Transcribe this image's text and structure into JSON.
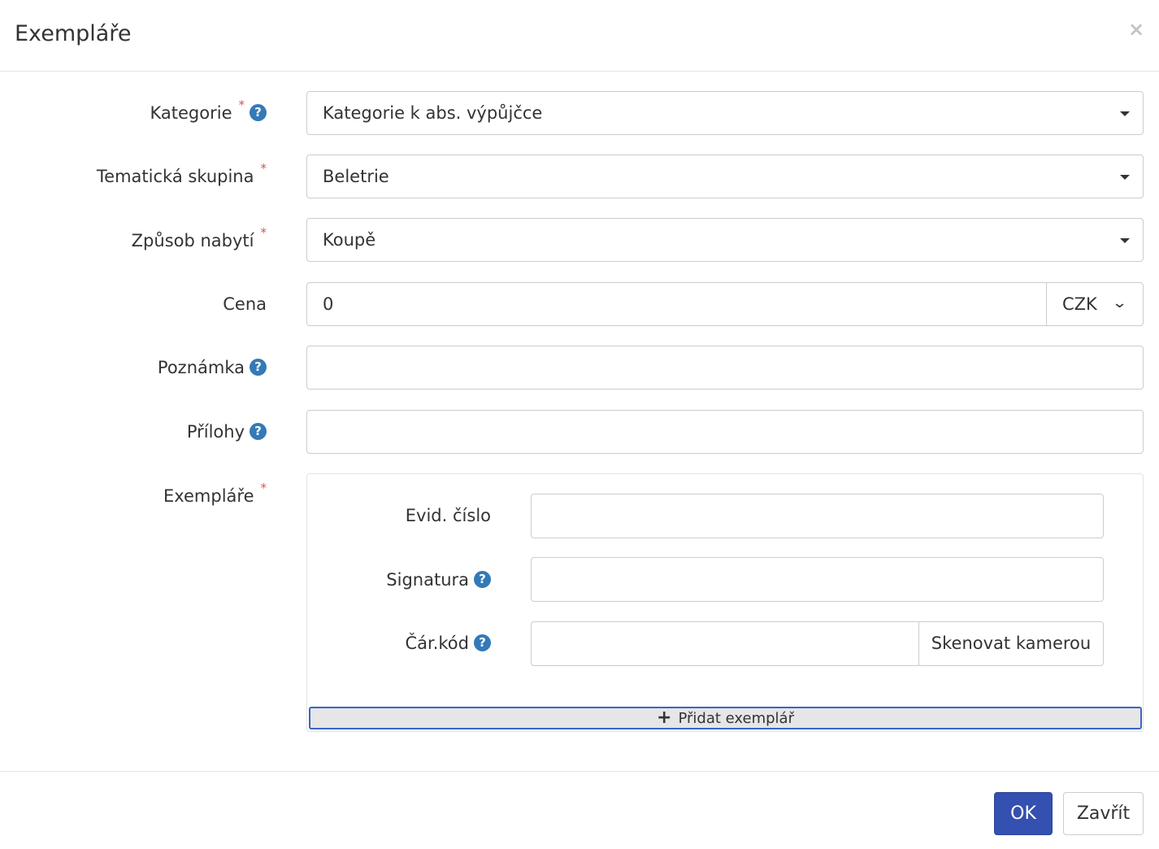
{
  "dialog": {
    "title": "Exempláře",
    "close_symbol": "×"
  },
  "form": {
    "required_mark": "*",
    "help_symbol": "?",
    "kategorie": {
      "label": "Kategorie",
      "value": "Kategorie k abs. výpůjčce"
    },
    "tematicka_skupina": {
      "label": "Tematická skupina",
      "value": "Beletrie"
    },
    "zpusob_nabyti": {
      "label": "Způsob nabytí",
      "value": "Koupě"
    },
    "cena": {
      "label": "Cena",
      "value": "0",
      "currency": "CZK"
    },
    "poznamka": {
      "label": "Poznámka",
      "value": ""
    },
    "prilohy": {
      "label": "Přílohy",
      "value": ""
    },
    "exemplare": {
      "label": "Exempláře",
      "evid_cislo": {
        "label": "Evid. číslo",
        "value": ""
      },
      "signatura": {
        "label": "Signatura",
        "value": ""
      },
      "car_kod": {
        "label": "Čár.kód",
        "value": "",
        "scan_label": "Skenovat kamerou"
      },
      "add_label": "Přidat exemplář"
    }
  },
  "footer": {
    "ok_label": "OK",
    "close_label": "Zavřít"
  },
  "colors": {
    "primary": "#3450b0",
    "help_icon": "#337ab7",
    "required": "#d9534f",
    "focus_border": "#3a66c4"
  },
  "icons": {
    "close": "close-icon",
    "help": "question-circle-icon",
    "caret": "caret-down-icon",
    "chevron": "chevron-down-icon",
    "plus": "plus-icon"
  }
}
